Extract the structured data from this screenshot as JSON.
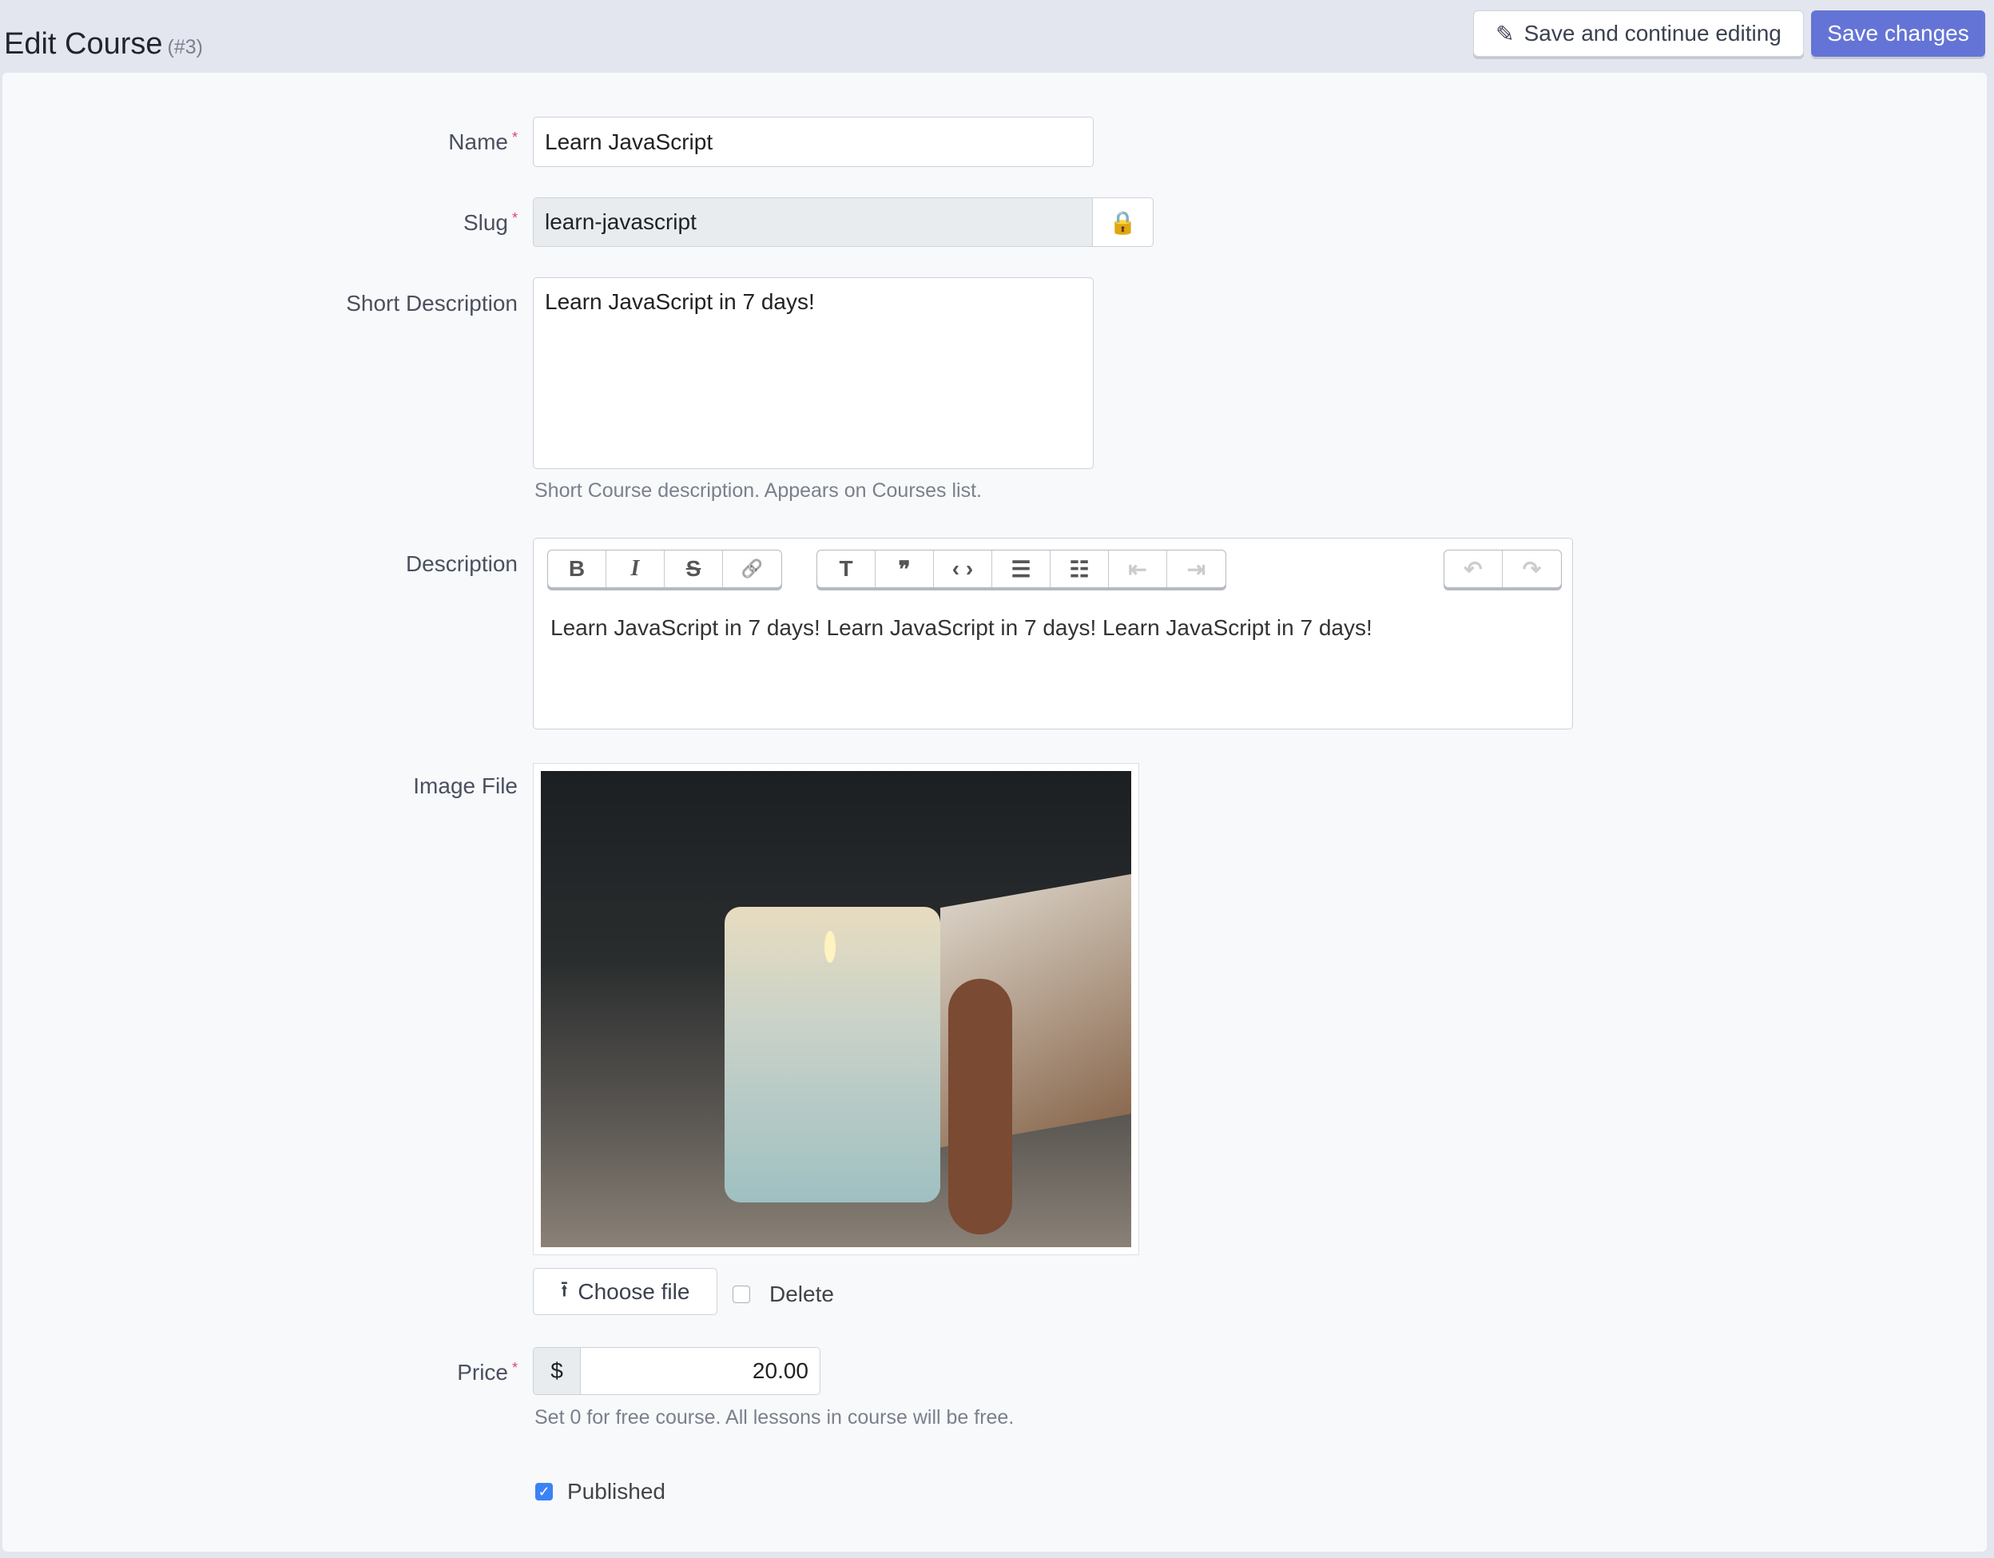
{
  "header": {
    "title": "Edit Course",
    "id": "(#3)",
    "save_continue": "Save and continue editing",
    "save": "Save changes"
  },
  "form": {
    "name": {
      "label": "Name",
      "value": "Learn JavaScript"
    },
    "slug": {
      "label": "Slug",
      "value": "learn-javascript"
    },
    "short_description": {
      "label": "Short Description",
      "value": "Learn JavaScript in 7 days!",
      "help": "Short Course description. Appears on Courses list."
    },
    "description": {
      "label": "Description",
      "value": "Learn JavaScript in 7 days! Learn JavaScript in 7 days! Learn JavaScript in 7 days!",
      "toolbar": {
        "bold": "B",
        "italic": "I",
        "strike": "S",
        "link": "🔗",
        "heading": "T",
        "quote": "❞",
        "code": "‹ ›",
        "bullets": "☰",
        "numbers": "☷",
        "outdent": "⇤",
        "indent": "⇥",
        "undo": "↶",
        "redo": "↷"
      }
    },
    "image": {
      "label": "Image File",
      "choose": "Choose file",
      "delete": "Delete"
    },
    "price": {
      "label": "Price",
      "currency": "$",
      "value": "20.00",
      "help": "Set 0 for free course. All lessons in course will be free."
    },
    "published": {
      "label": "Published",
      "checked": true
    }
  }
}
